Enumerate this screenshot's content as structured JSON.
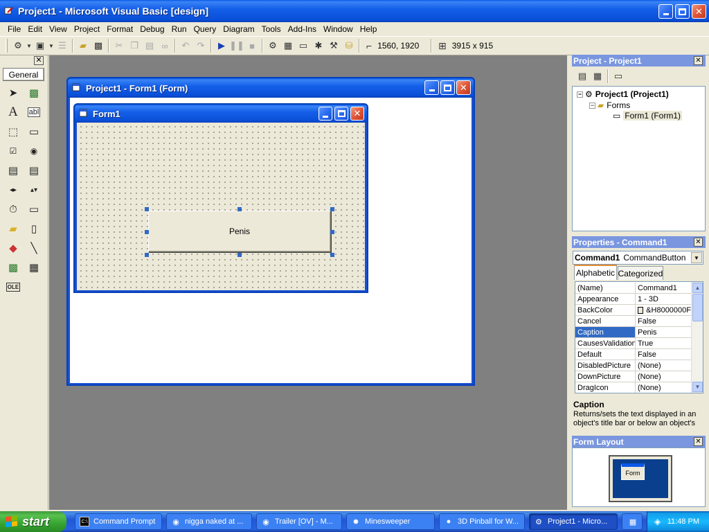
{
  "main_window": {
    "title": "Project1 - Microsoft Visual Basic [design]"
  },
  "menubar": {
    "items": [
      "File",
      "Edit",
      "View",
      "Project",
      "Format",
      "Debug",
      "Run",
      "Query",
      "Diagram",
      "Tools",
      "Add-Ins",
      "Window",
      "Help"
    ]
  },
  "toolbar": {
    "position_readout": "1560, 1920",
    "size_readout": "3915 x 915"
  },
  "toolbox": {
    "tab_label": "General",
    "text_tool_glyph": "A",
    "textbox_tool_glyph": "abl",
    "ole_tool_glyph": "OLE"
  },
  "designer_window": {
    "title": "Project1 - Form1 (Form)"
  },
  "form1": {
    "title": "Form1",
    "button_caption": "Penis"
  },
  "project_panel": {
    "title": "Project - Project1",
    "tree": {
      "project": "Project1 (Project1)",
      "folder": "Forms",
      "form": "Form1 (Form1)"
    }
  },
  "properties_panel": {
    "title": "Properties - Command1",
    "object_name": "Command1",
    "object_type": "CommandButton",
    "tabs": [
      "Alphabetic",
      "Categorized"
    ],
    "rows": [
      {
        "name": "(Name)",
        "value": "Command1"
      },
      {
        "name": "Appearance",
        "value": "1 - 3D"
      },
      {
        "name": "BackColor",
        "value": "&H8000000F"
      },
      {
        "name": "Cancel",
        "value": "False"
      },
      {
        "name": "Caption",
        "value": "Penis"
      },
      {
        "name": "CausesValidation",
        "value": "True"
      },
      {
        "name": "Default",
        "value": "False"
      },
      {
        "name": "DisabledPicture",
        "value": "(None)"
      },
      {
        "name": "DownPicture",
        "value": "(None)"
      },
      {
        "name": "DragIcon",
        "value": "(None)"
      }
    ],
    "selected_row": 4,
    "description_title": "Caption",
    "description_text": "Returns/sets the text displayed in an object's title bar or below an object's"
  },
  "form_layout_panel": {
    "title": "Form Layout",
    "mini_form_label": "Form"
  },
  "taskbar": {
    "start_label": "start",
    "tasks": [
      {
        "label": "Command Prompt"
      },
      {
        "label": "nigga naked at ..."
      },
      {
        "label": "Trailer [OV] - M..."
      },
      {
        "label": "Minesweeper"
      },
      {
        "label": "3D Pinball for W..."
      },
      {
        "label": "Project1 - Micro..."
      }
    ],
    "clock": "11:48 PM"
  },
  "colors": {
    "xp_title_blue": "#0a58e8",
    "face": "#ece9d8",
    "workspace": "#808080",
    "selection": "#316ac5",
    "start_green": "#37a432"
  }
}
